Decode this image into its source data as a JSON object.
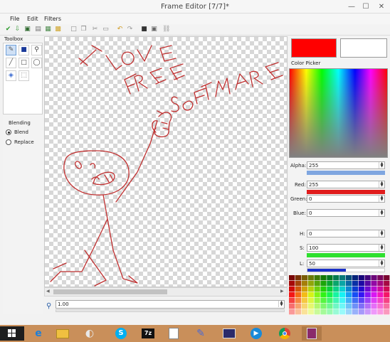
{
  "window": {
    "title": "Frame Editor [7/7]*",
    "minimize": "—",
    "maximize": "☐",
    "close": "✕"
  },
  "menu": [
    "File",
    "Edit",
    "Filters"
  ],
  "toolbox": {
    "label": "Toolbox"
  },
  "blending": {
    "label": "Blending",
    "options": [
      "Blend",
      "Replace"
    ],
    "selected": "Blend"
  },
  "zoom": {
    "value": "1.00"
  },
  "colors": {
    "primary": "#FF0000",
    "secondary": "#FFFFFF",
    "stroke": "#c03030"
  },
  "color_picker": {
    "label": "Color Picker",
    "alpha": {
      "label": "Alpha:",
      "value": "255"
    },
    "red": {
      "label": "Red:",
      "value": "255"
    },
    "green": {
      "label": "Green:",
      "value": "0"
    },
    "blue": {
      "label": "Blue:",
      "value": "0"
    },
    "h": {
      "label": "H:",
      "value": "0"
    },
    "s": {
      "label": "S:",
      "value": "100"
    },
    "l": {
      "label": "L:",
      "value": "50"
    }
  },
  "drawing": {
    "text_lines": [
      "I LOVE",
      "FREE",
      "SOFTWARE"
    ]
  }
}
